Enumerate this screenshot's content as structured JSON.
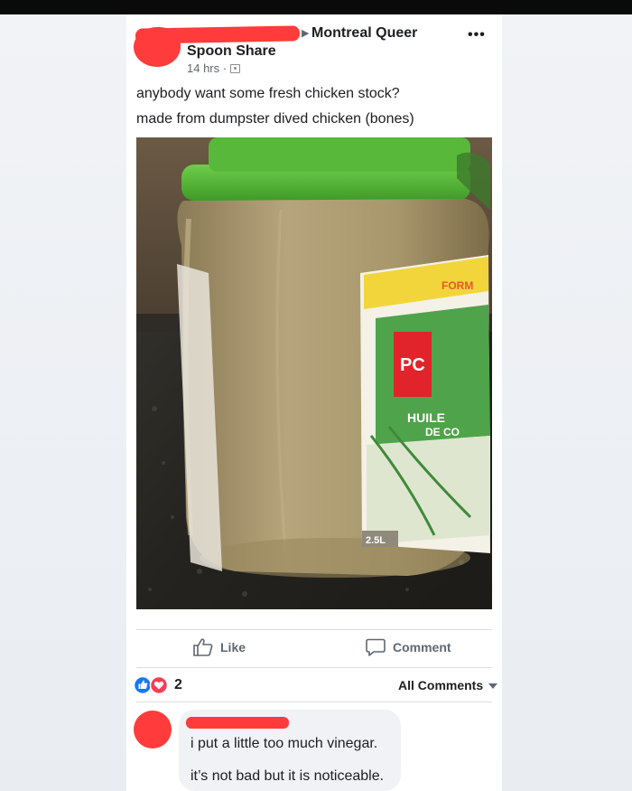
{
  "post": {
    "group_name_line1": "Montreal Queer",
    "group_name_line2": "Spoon Share",
    "timestamp": "14 hrs ·",
    "more_icon": "•••",
    "text_line1": "anybody want some fresh chicken stock?",
    "text_line2": "made from dumpster dived chicken (bones)",
    "photo": {
      "label_brand": "PC",
      "label_text1": "HUILE",
      "label_text2": "DE CO",
      "label_top": "FORM",
      "label_volume": "2.5L"
    }
  },
  "actions": {
    "like_label": "Like",
    "comment_label": "Comment"
  },
  "reactions": {
    "count": "2",
    "types": [
      "like-icon",
      "love-icon"
    ]
  },
  "comments_filter": {
    "label": "All Comments"
  },
  "comment": {
    "line1": "i put a little too much vinegar.",
    "line2": "it’s not bad but it is noticeable."
  },
  "colors": {
    "accent_blue": "#1877f2",
    "love_red": "#f33e58",
    "redaction_red": "#ff3b3b"
  }
}
